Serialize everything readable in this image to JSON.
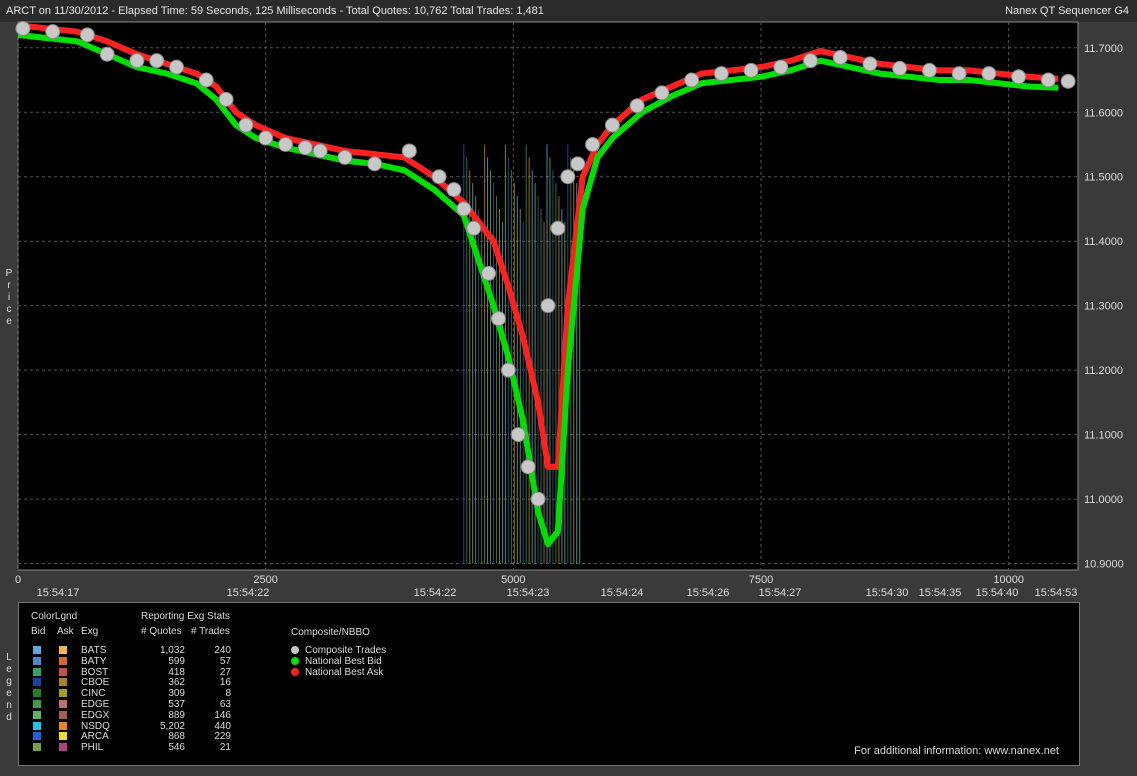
{
  "header": {
    "info": "ARCT on 11/30/2012  -  Elapsed Time: 59 Seconds, 125 Milliseconds  -  Total Quotes: 10,762  Total Trades: 1,481",
    "app_title": "Nanex QT Sequencer G4"
  },
  "side_labels": {
    "price": "Price",
    "legend": "Legend"
  },
  "chart_data": {
    "type": "line",
    "ylabel": "Price",
    "ylim": [
      10.89,
      11.74
    ],
    "xlim": [
      0,
      10700
    ],
    "y_ticks": [
      "11.7000",
      "11.6000",
      "11.5000",
      "11.4000",
      "11.3000",
      "11.2000",
      "11.1000",
      "11.0000",
      "10.9000"
    ],
    "y_tick_values": [
      11.7,
      11.6,
      11.5,
      11.4,
      11.3,
      11.2,
      11.1,
      11.0,
      10.9
    ],
    "x_ticks": [
      "0",
      "2500",
      "5000",
      "7500",
      "10000"
    ],
    "x_tick_values": [
      0,
      2500,
      5000,
      7500,
      10000
    ],
    "time_labels": [
      {
        "x": 0,
        "label": "15:54:17"
      },
      {
        "x": 2500,
        "label": "15:54:22"
      },
      {
        "x": 5000,
        "label": "15:54:22"
      },
      {
        "x": 5300,
        "label": "15:54:23"
      },
      {
        "x": 6350,
        "label": "15:54:24"
      },
      {
        "x": 7350,
        "label": "15:54:26"
      },
      {
        "x": 8200,
        "label": "15:54:27"
      },
      {
        "x": 10100,
        "label": "15:54:30"
      },
      {
        "x": 10500,
        "label": "15:54:35"
      },
      {
        "x": 11100,
        "label": "15:54:40"
      },
      {
        "x": 11700,
        "label": "15:54:53"
      }
    ],
    "series": [
      {
        "name": "National Best Ask",
        "color": "#ff2020",
        "x": [
          0,
          300,
          600,
          900,
          1200,
          1500,
          1800,
          2000,
          2200,
          2400,
          2700,
          3000,
          3300,
          3600,
          3900,
          4200,
          4500,
          4800,
          4950,
          5100,
          5250,
          5350,
          5450,
          5550,
          5700,
          5850,
          6000,
          6300,
          6600,
          6900,
          7200,
          7500,
          7800,
          8100,
          8400,
          8700,
          9000,
          9300,
          9600,
          9900,
          10200,
          10500
        ],
        "y": [
          11.735,
          11.73,
          11.725,
          11.71,
          11.69,
          11.675,
          11.66,
          11.64,
          11.6,
          11.58,
          11.56,
          11.55,
          11.54,
          11.535,
          11.53,
          11.5,
          11.46,
          11.4,
          11.33,
          11.25,
          11.15,
          11.05,
          11.05,
          11.3,
          11.5,
          11.55,
          11.58,
          11.62,
          11.64,
          11.66,
          11.665,
          11.67,
          11.68,
          11.695,
          11.685,
          11.675,
          11.67,
          11.665,
          11.665,
          11.66,
          11.655,
          11.652
        ]
      },
      {
        "name": "National Best Bid",
        "color": "#00e000",
        "x": [
          0,
          300,
          600,
          900,
          1200,
          1500,
          1800,
          2000,
          2200,
          2400,
          2700,
          3000,
          3300,
          3600,
          3900,
          4200,
          4500,
          4800,
          4950,
          5100,
          5250,
          5350,
          5450,
          5550,
          5700,
          5850,
          6000,
          6300,
          6600,
          6900,
          7200,
          7500,
          7800,
          8100,
          8400,
          8700,
          9000,
          9300,
          9600,
          9900,
          10200,
          10500
        ],
        "y": [
          11.72,
          11.715,
          11.71,
          11.69,
          11.67,
          11.66,
          11.645,
          11.62,
          11.58,
          11.56,
          11.545,
          11.535,
          11.525,
          11.52,
          11.51,
          11.48,
          11.44,
          11.3,
          11.22,
          11.12,
          10.98,
          10.93,
          10.95,
          11.2,
          11.45,
          11.53,
          11.56,
          11.6,
          11.625,
          11.645,
          11.65,
          11.655,
          11.665,
          11.68,
          11.67,
          11.66,
          11.655,
          11.65,
          11.65,
          11.645,
          11.64,
          11.638
        ]
      },
      {
        "name": "Composite Trades",
        "color": "#c8c8c8",
        "x": [
          50,
          350,
          700,
          900,
          1200,
          1400,
          1600,
          1900,
          2100,
          2300,
          2500,
          2700,
          2900,
          3050,
          3300,
          3600,
          3950,
          4250,
          4400,
          4500,
          4600,
          4750,
          4850,
          4950,
          5050,
          5150,
          5250,
          5350,
          5450,
          5550,
          5650,
          5800,
          6000,
          6250,
          6500,
          6800,
          7100,
          7400,
          7700,
          8000,
          8300,
          8600,
          8900,
          9200,
          9500,
          9800,
          10100,
          10400,
          10600
        ],
        "y": [
          11.73,
          11.725,
          11.72,
          11.69,
          11.68,
          11.68,
          11.67,
          11.65,
          11.62,
          11.58,
          11.56,
          11.55,
          11.545,
          11.54,
          11.53,
          11.52,
          11.54,
          11.5,
          11.48,
          11.45,
          11.42,
          11.35,
          11.28,
          11.2,
          11.1,
          11.05,
          11.0,
          11.3,
          11.42,
          11.5,
          11.52,
          11.55,
          11.58,
          11.61,
          11.63,
          11.65,
          11.66,
          11.665,
          11.67,
          11.68,
          11.685,
          11.675,
          11.668,
          11.665,
          11.66,
          11.66,
          11.655,
          11.65,
          11.648
        ]
      }
    ]
  },
  "legend": {
    "colorlgnd": "ColorLgnd",
    "reporting": "Reporting Exg Stats",
    "col_bid": "Bid",
    "col_ask": "Ask",
    "col_exg": "Exg",
    "col_quotes": "# Quotes",
    "col_trades": "# Trades",
    "rows": [
      {
        "exg": "BATS",
        "quotes": "1,032",
        "trades": "240",
        "bid": "#5fa8e0",
        "ask": "#f0b848"
      },
      {
        "exg": "BATY",
        "quotes": "599",
        "trades": "57",
        "bid": "#4f88c8",
        "ask": "#d86830"
      },
      {
        "exg": "BOST",
        "quotes": "418",
        "trades": "27",
        "bid": "#3aa060",
        "ask": "#c05050"
      },
      {
        "exg": "CBOE",
        "quotes": "362",
        "trades": "16",
        "bid": "#2040a0",
        "ask": "#b08020"
      },
      {
        "exg": "CINC",
        "quotes": "309",
        "trades": "8",
        "bid": "#208020",
        "ask": "#a0a020"
      },
      {
        "exg": "EDGE",
        "quotes": "537",
        "trades": "63",
        "bid": "#40a040",
        "ask": "#c07070"
      },
      {
        "exg": "EDGX",
        "quotes": "889",
        "trades": "146",
        "bid": "#60b060",
        "ask": "#a06050"
      },
      {
        "exg": "NSDQ",
        "quotes": "5,202",
        "trades": "440",
        "bid": "#20c0f0",
        "ask": "#f08020"
      },
      {
        "exg": "ARCA",
        "quotes": "868",
        "trades": "229",
        "bid": "#2060e0",
        "ask": "#f0e020"
      },
      {
        "exg": "PHIL",
        "quotes": "546",
        "trades": "21",
        "bid": "#70a040",
        "ask": "#b04080"
      }
    ],
    "composite_title": "Composite/NBBO",
    "composite_items": [
      {
        "label": "Composite Trades",
        "color": "#c8c8c8"
      },
      {
        "label": "National Best Bid",
        "color": "#00e000"
      },
      {
        "label": "National Best Ask",
        "color": "#ff2020"
      }
    ],
    "footer": "For additional information: www.nanex.net"
  }
}
